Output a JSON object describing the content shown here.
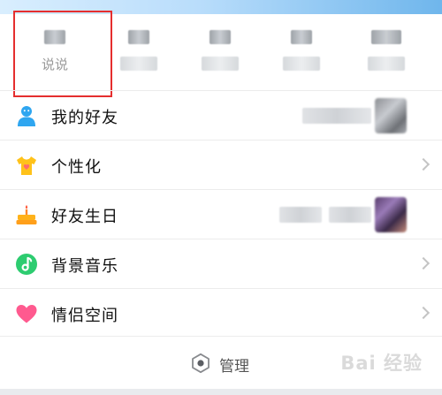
{
  "stats": {
    "shuoshuo_label": "说说"
  },
  "menu": {
    "items": [
      {
        "label": "我的好友",
        "icon": "friends-person-icon",
        "accessory": "blurred-preview"
      },
      {
        "label": "个性化",
        "icon": "tshirt-icon",
        "accessory": "chevron"
      },
      {
        "label": "好友生日",
        "icon": "birthday-cake-icon",
        "accessory": "blurred-preview"
      },
      {
        "label": "背景音乐",
        "icon": "music-note-icon",
        "accessory": "chevron"
      },
      {
        "label": "情侣空间",
        "icon": "heart-icon",
        "accessory": "chevron"
      }
    ]
  },
  "footer": {
    "manage_label": "管理",
    "watermark": "Bai 经验"
  },
  "colors": {
    "highlight_border": "#e52e2e",
    "friends_icon": "#2fa6f0",
    "tshirt_icon": "#ffc21a",
    "cake_icon": "#ff9f1a",
    "music_icon": "#2dcc70",
    "heart_icon": "#ff5a8f"
  }
}
